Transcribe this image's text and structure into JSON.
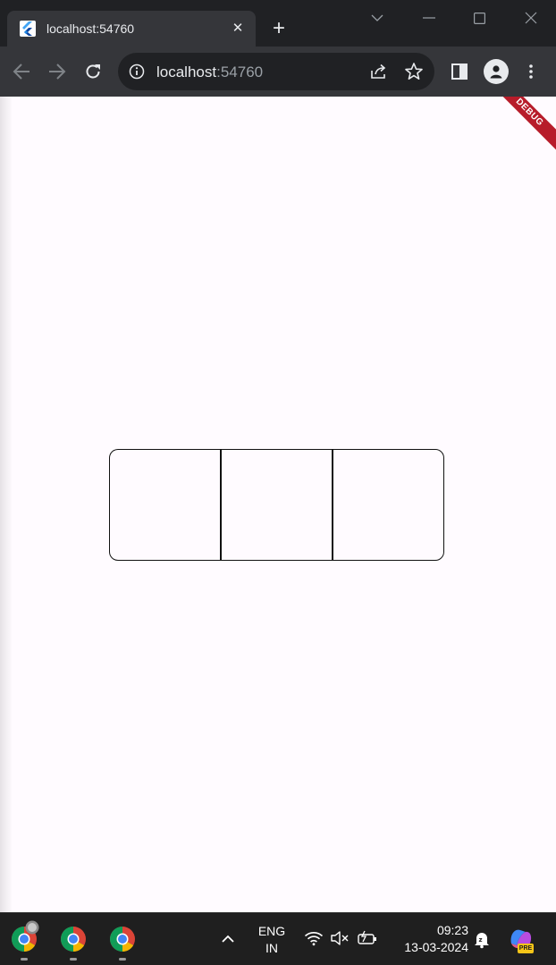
{
  "browser": {
    "tab_title": "localhost:54760",
    "url_host": "localhost",
    "url_port": ":54760"
  },
  "app": {
    "debug_banner": "DEBUG",
    "segments": [
      {
        "label": ""
      },
      {
        "label": ""
      },
      {
        "label": ""
      }
    ]
  },
  "taskbar": {
    "lang_line1": "ENG",
    "lang_line2": "IN",
    "time": "09:23",
    "date": "13-03-2024",
    "copilot_badge": "PRE"
  },
  "colors": {
    "frame": "#202124",
    "toolbar": "#35363a",
    "viewport_bg": "#fffbff",
    "debug_banner": "#b71c2a",
    "taskbar": "#1f1f1f"
  }
}
